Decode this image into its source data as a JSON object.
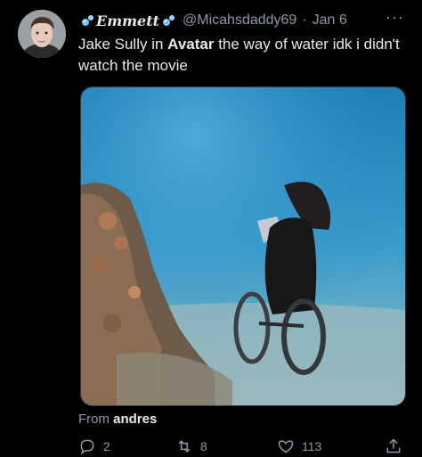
{
  "tweet": {
    "display_name": "Emmett",
    "handle": "@Micahsdaddy69",
    "separator": "·",
    "date": "Jan 6",
    "more": "···",
    "text_prefix": "Jake Sully in ",
    "text_bold": "Avatar",
    "text_suffix": " the way of water idk i didn't watch the movie"
  },
  "source": {
    "prefix": "From",
    "name": "andres"
  },
  "actions": {
    "replies": "2",
    "retweets": "8",
    "likes": "113"
  },
  "icons": [
    "avatar",
    "bubbles-icon",
    "more-icon",
    "reply-icon",
    "retweet-icon",
    "like-icon",
    "share-icon"
  ],
  "colors": {
    "background": "#000000",
    "text": "#e7e9ea",
    "secondary": "#8b98a5"
  }
}
